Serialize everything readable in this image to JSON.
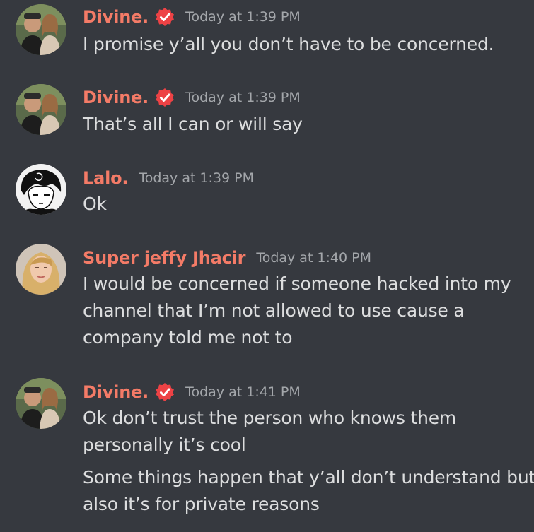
{
  "messages": [
    {
      "author": "Divine.",
      "verified": true,
      "timestamp": "Today at 1:39 PM",
      "avatar_icon": "couple-avatar-icon",
      "lines": [
        "I promise y’all you don’t have to be concerned."
      ]
    },
    {
      "author": "Divine.",
      "verified": true,
      "timestamp": "Today at 1:39 PM",
      "avatar_icon": "couple-avatar-icon",
      "lines": [
        "That’s all I can or will say"
      ]
    },
    {
      "author": "Lalo.",
      "verified": false,
      "timestamp": "Today at 1:39 PM",
      "avatar_icon": "manga-avatar-icon",
      "lines": [
        "Ok"
      ]
    },
    {
      "author": "Super jeffy Jhacir",
      "verified": false,
      "timestamp": "Today at 1:40 PM",
      "avatar_icon": "blonde-avatar-icon",
      "lines": [
        "I would be concerned if someone hacked into my",
        "channel that I’m not allowed to use cause a",
        "company told me not to"
      ]
    },
    {
      "author": "Divine.",
      "verified": true,
      "timestamp": "Today at 1:41 PM",
      "avatar_icon": "couple-avatar-icon",
      "lines": [
        "Ok don’t trust the person who knows them",
        "personally it’s cool",
        "Some things happen that y’all don’t understand but",
        "also it’s for private reasons"
      ]
    }
  ],
  "colors": {
    "background": "#36393f",
    "author": "#f47b67",
    "timestamp": "#a3a6aa",
    "text": "#dcddde",
    "verified_badge": "#ed4245"
  }
}
